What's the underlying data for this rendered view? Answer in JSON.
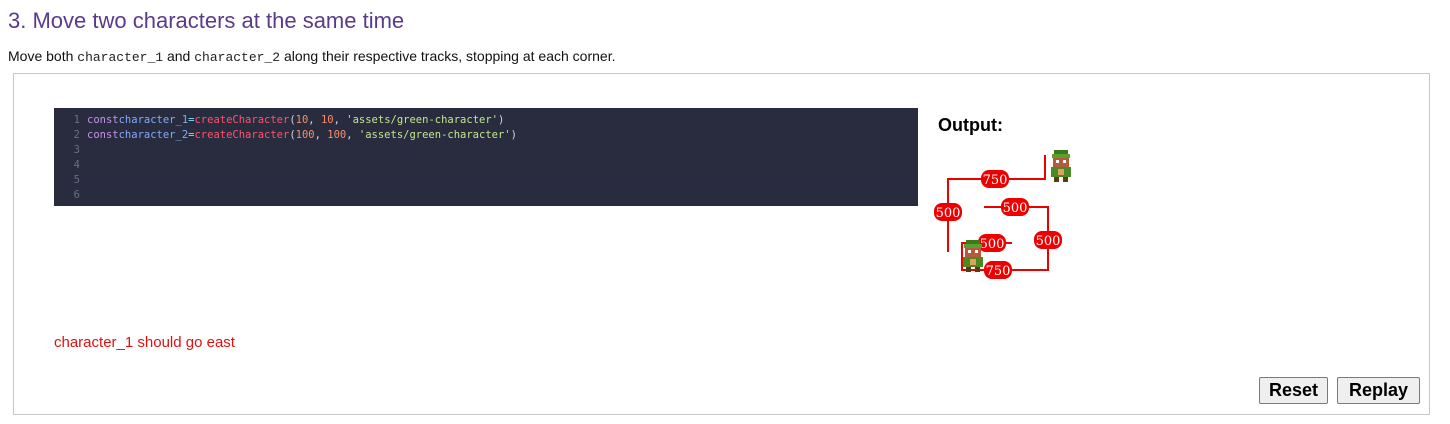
{
  "section": {
    "title": "3. Move two characters at the same time",
    "instructions": {
      "before": "Move both ",
      "code1": "character_1",
      "mid": " and ",
      "code2": "character_2",
      "after": " along their respective tracks, stopping at each corner."
    }
  },
  "editor": {
    "line_numbers": [
      "1",
      "2",
      "3",
      "4",
      "5",
      "6"
    ],
    "lines": [
      {
        "kw": "const",
        "var": "character_1",
        "op": "=",
        "fn": "createCharacter",
        "arg1": "10",
        "arg2": "10",
        "str": "'assets/green-character'"
      },
      {
        "kw": "const",
        "var": "character_2",
        "op": "=",
        "fn": "createCharacter",
        "arg1": "100",
        "arg2": "100",
        "str": "'assets/green-character'"
      }
    ]
  },
  "output": {
    "label": "Output:",
    "track_labels": [
      "750",
      "500",
      "500",
      "500",
      "500",
      "750"
    ],
    "track_color": "#ee0000"
  },
  "error_message": "character_1 should go east",
  "buttons": {
    "reset": "Reset",
    "replay": "Replay"
  }
}
